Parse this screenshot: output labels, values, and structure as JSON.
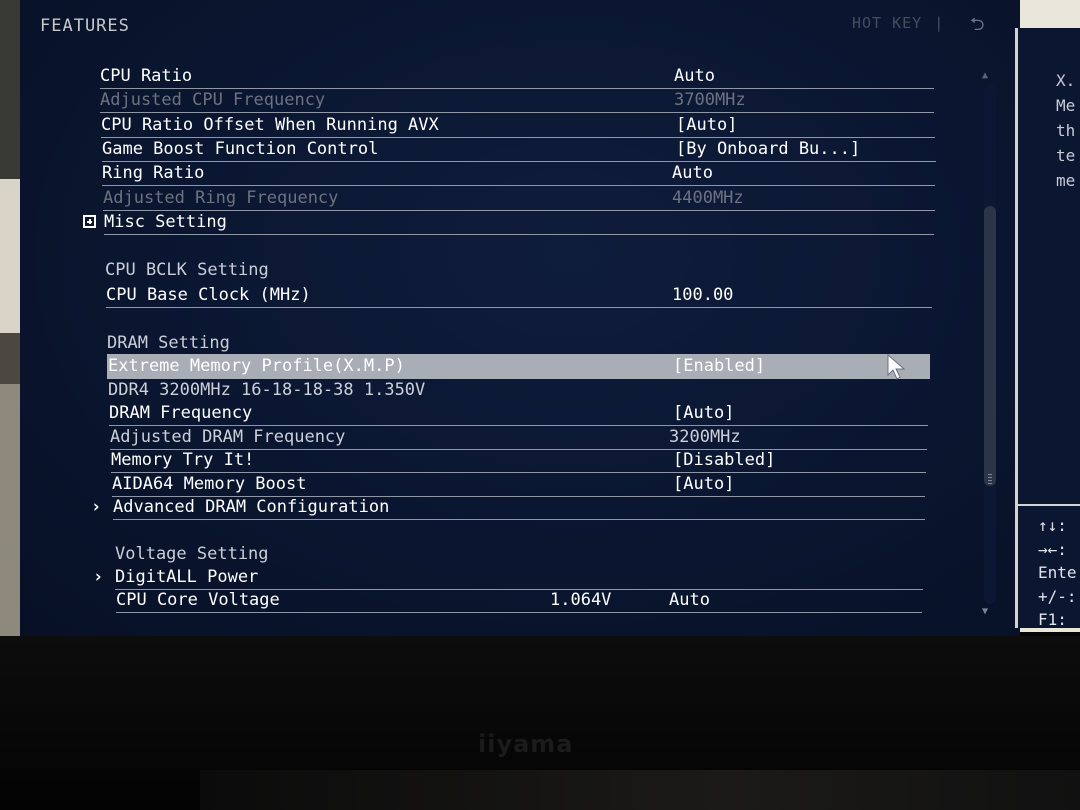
{
  "header": {
    "title": "FEATURES",
    "hotkey_label": "HOT KEY",
    "separator": "|",
    "back_icon": "undo-arrow-icon"
  },
  "settings": {
    "cpu_ratio": {
      "label": "CPU Ratio",
      "value": "Auto"
    },
    "adjusted_cpu_frequency": {
      "label": "Adjusted CPU Frequency",
      "value": "3700MHz"
    },
    "cpu_ratio_offset_avx": {
      "label": "CPU Ratio Offset When Running AVX",
      "value": "[Auto]"
    },
    "game_boost": {
      "label": "Game Boost Function Control",
      "value": "[By Onboard Bu...]"
    },
    "ring_ratio": {
      "label": "Ring Ratio",
      "value": "Auto"
    },
    "adjusted_ring_frequency": {
      "label": "Adjusted Ring Frequency",
      "value": "4400MHz"
    },
    "misc_setting": {
      "label": "Misc Setting",
      "prefix": "⊞"
    },
    "cpu_bclk_section": "CPU BCLK Setting",
    "cpu_base_clock": {
      "label": "CPU Base Clock (MHz)",
      "value": "100.00"
    },
    "dram_section": "DRAM Setting",
    "xmp": {
      "label": "Extreme Memory Profile(X.M.P)",
      "value": "[Enabled]"
    },
    "xmp_profile_info": "DDR4 3200MHz 16-18-18-38 1.350V",
    "dram_frequency": {
      "label": "DRAM Frequency",
      "value": "[Auto]"
    },
    "adjusted_dram_frequency": {
      "label": "Adjusted DRAM Frequency",
      "value": "3200MHz"
    },
    "memory_try_it": {
      "label": "Memory Try It!",
      "value": "[Disabled]"
    },
    "aida64_boost": {
      "label": "AIDA64 Memory Boost",
      "value": "[Auto]"
    },
    "advanced_dram": {
      "label": "Advanced DRAM Configuration",
      "prefix": "›"
    },
    "voltage_section": "Voltage Setting",
    "digitall_power": {
      "label": "DigitALL Power",
      "prefix": "›"
    },
    "cpu_core_voltage": {
      "label": "CPU Core Voltage",
      "current": "1.064V",
      "value": "Auto"
    }
  },
  "help_panel": {
    "text_lines": [
      "X.",
      "Me",
      "th",
      "te",
      "me"
    ],
    "keys": [
      "↑↓:",
      "→←:",
      "Ente",
      "+/-:",
      "F1:"
    ]
  },
  "monitor": {
    "brand": "iiyama"
  },
  "colors": {
    "background": "#0a1630",
    "highlight": "#a8adb6",
    "dim_text": "#6d7280"
  }
}
